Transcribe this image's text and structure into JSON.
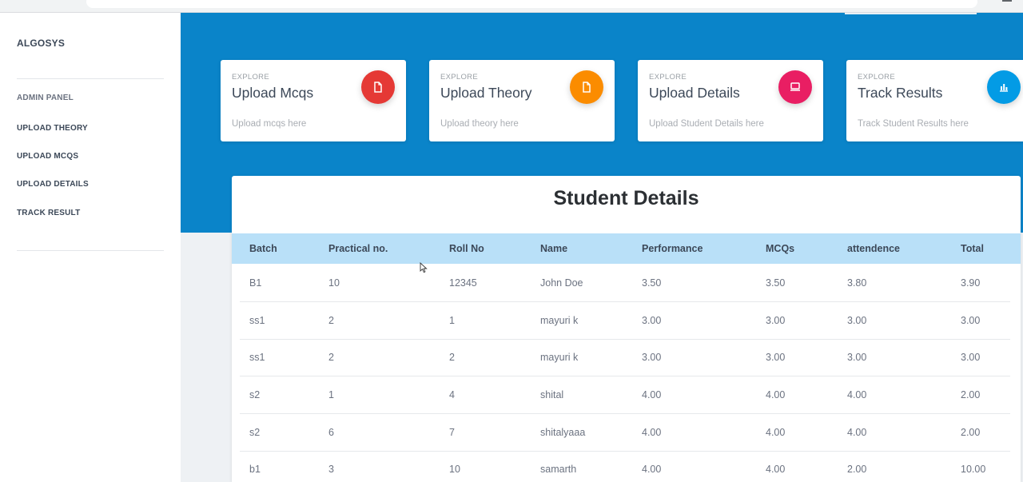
{
  "app": {
    "brand": "ALGOSYS"
  },
  "sidebar": {
    "items": [
      {
        "label": "ADMIN PANEL"
      },
      {
        "label": "UPLOAD THEORY"
      },
      {
        "label": "UPLOAD MCQS"
      },
      {
        "label": "UPLOAD DETAILS"
      },
      {
        "label": "TRACK RESULT"
      }
    ]
  },
  "cards": [
    {
      "eyebrow": "EXPLORE",
      "title": "Upload Mcqs",
      "subtitle": "Upload mcqs here",
      "icon": "document-icon",
      "color": "#e53935"
    },
    {
      "eyebrow": "EXPLORE",
      "title": "Upload Theory",
      "subtitle": "Upload theory here",
      "icon": "document-icon",
      "color": "#fb8c00"
    },
    {
      "eyebrow": "EXPLORE",
      "title": "Upload Details",
      "subtitle": "Upload Student Details here",
      "icon": "laptop-icon",
      "color": "#e91e63"
    },
    {
      "eyebrow": "EXPLORE",
      "title": "Track Results",
      "subtitle": "Track Student Results here",
      "icon": "bar-chart-icon",
      "color": "#039be5"
    }
  ],
  "table": {
    "title": "Student Details",
    "headers": [
      "Batch",
      "Practical no.",
      "Roll No",
      "Name",
      "Performance",
      "MCQs",
      "attendence",
      "Total"
    ],
    "rows": [
      [
        "B1",
        "10",
        "12345",
        "John Doe",
        "3.50",
        "3.50",
        "3.80",
        "3.90"
      ],
      [
        "ss1",
        "2",
        "1",
        "mayuri k",
        "3.00",
        "3.00",
        "3.00",
        "3.00"
      ],
      [
        "ss1",
        "2",
        "2",
        "mayuri k",
        "3.00",
        "3.00",
        "3.00",
        "3.00"
      ],
      [
        "s2",
        "1",
        "4",
        "shital",
        "4.00",
        "4.00",
        "4.00",
        "2.00"
      ],
      [
        "s2",
        "6",
        "7",
        "shitalyaaa",
        "4.00",
        "4.00",
        "4.00",
        "2.00"
      ],
      [
        "b1",
        "3",
        "10",
        "samarth",
        "4.00",
        "4.00",
        "2.00",
        "10.00"
      ]
    ]
  },
  "colors": {
    "hero": "#0a84c9",
    "table_header": "#b9e0f8"
  }
}
